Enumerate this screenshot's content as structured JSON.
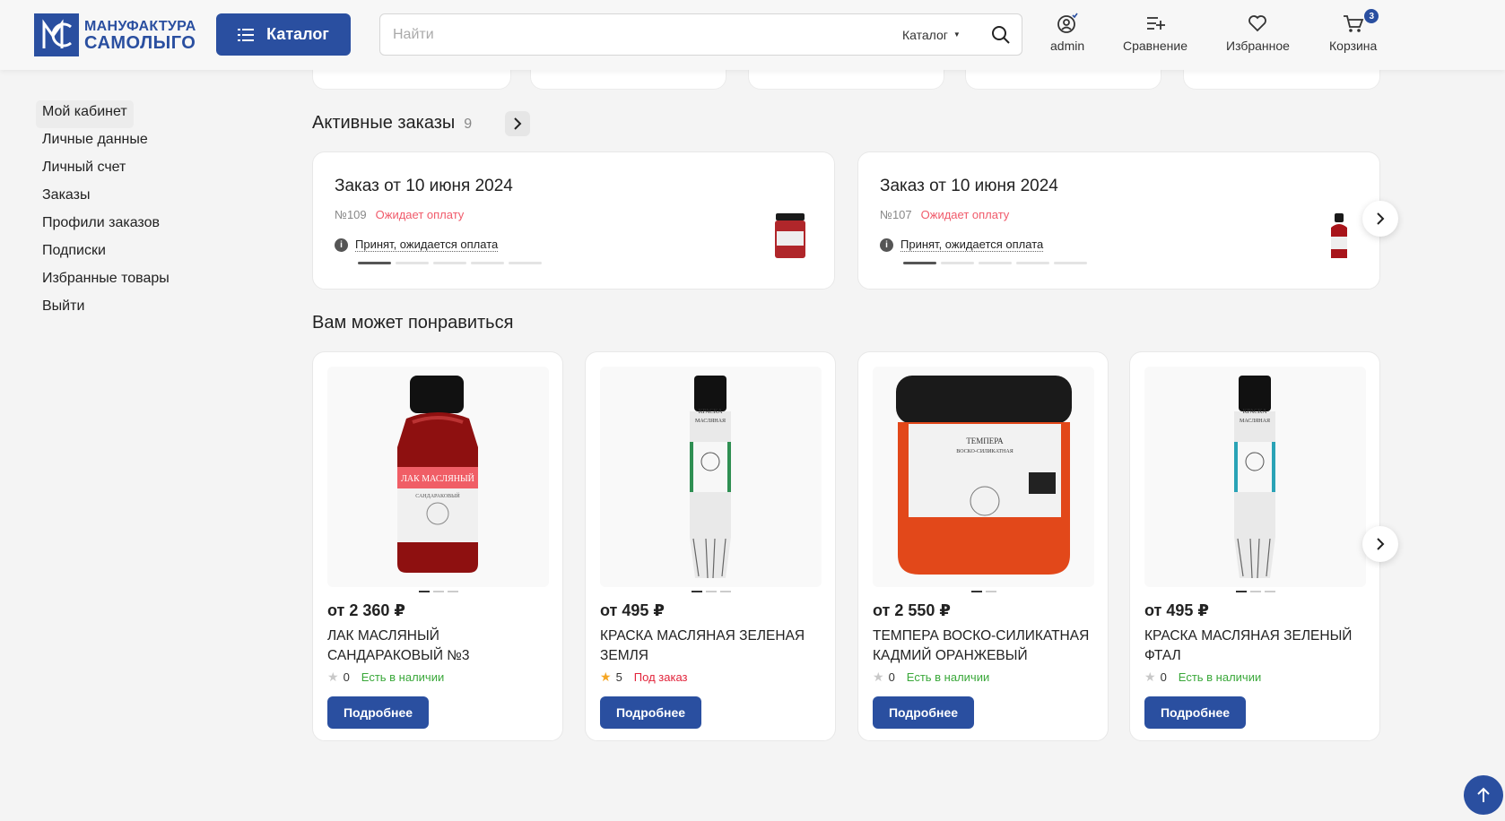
{
  "header": {
    "logo_line1": "МАНУФАКТУРА",
    "logo_line2": "САМОЛЫГО",
    "catalog_label": "Каталог",
    "search_placeholder": "Найти",
    "search_scope": "Каталог",
    "icons": {
      "user_label": "admin",
      "compare_label": "Сравнение",
      "favorites_label": "Избранное",
      "cart_label": "Корзина",
      "cart_count": "3"
    }
  },
  "sidebar": {
    "items": [
      {
        "label": "Мой кабинет"
      },
      {
        "label": "Личные данные"
      },
      {
        "label": "Личный счет"
      },
      {
        "label": "Заказы"
      },
      {
        "label": "Профили заказов"
      },
      {
        "label": "Подписки"
      },
      {
        "label": "Избранные товары"
      },
      {
        "label": "Выйти"
      }
    ]
  },
  "orders": {
    "title": "Активные заказы",
    "count": "9",
    "items": [
      {
        "title": "Заказ от 10 июня 2024",
        "number": "№109",
        "status": "Ожидает оплату",
        "info": "Принят, ожидается оплата"
      },
      {
        "title": "Заказ от 10 июня 2024",
        "number": "№107",
        "status": "Ожидает оплату",
        "info": "Принят, ожидается оплата"
      }
    ]
  },
  "recommend": {
    "title": "Вам может понравиться",
    "more_label": "Подробнее",
    "products": [
      {
        "price": "от 2 360 ₽",
        "name": "Лак масляный сандараковый №3",
        "rating": "0",
        "availability": "Есть в наличии",
        "label_top": "ЛАК МАСЛЯНЫЙ",
        "label_sub": "САНДАРАКОВЫЙ"
      },
      {
        "price": "от 495 ₽",
        "name": "Краска масляная зеленая земля",
        "rating": "5",
        "availability": "Под заказ",
        "label_top": "КРАСКА",
        "label_sub": "МАСЛЯНАЯ"
      },
      {
        "price": "от 2 550 ₽",
        "name": "Темпера воско-силикатная кадмий оранжевый",
        "rating": "0",
        "availability": "Есть в наличии",
        "label_top": "ТЕМПЕРА",
        "label_sub": "ВОСКО-СИЛИКАТНАЯ"
      },
      {
        "price": "от 495 ₽",
        "name": "Краска масляная зеленый фтал",
        "rating": "0",
        "availability": "Есть в наличии",
        "label_top": "КРАСКА",
        "label_sub": "МАСЛЯНАЯ"
      }
    ]
  },
  "colors": {
    "brand": "#2a4fa0",
    "status_pending": "#f05a6a",
    "in_stock": "#3aa83a",
    "on_order": "#e2243b"
  }
}
